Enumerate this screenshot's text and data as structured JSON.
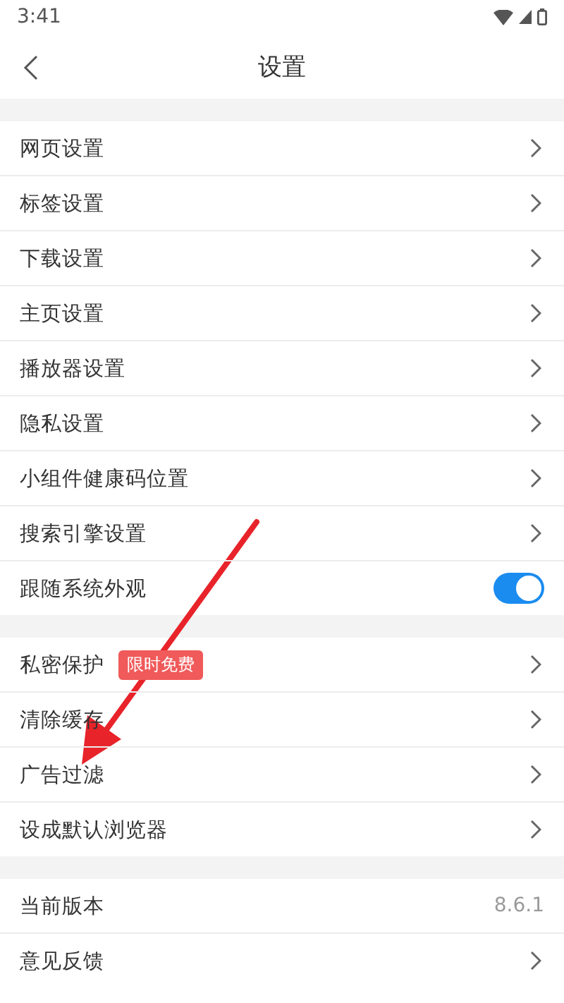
{
  "status_bar": {
    "time": "3:41"
  },
  "header": {
    "title": "设置"
  },
  "sections": [
    {
      "rows": [
        {
          "kind": "link",
          "label": "网页设置"
        },
        {
          "kind": "link",
          "label": "标签设置"
        },
        {
          "kind": "link",
          "label": "下载设置"
        },
        {
          "kind": "link",
          "label": "主页设置"
        },
        {
          "kind": "link",
          "label": "播放器设置"
        },
        {
          "kind": "link",
          "label": "隐私设置"
        },
        {
          "kind": "link",
          "label": "小组件健康码位置"
        },
        {
          "kind": "link",
          "label": "搜索引擎设置"
        },
        {
          "kind": "toggle",
          "label": "跟随系统外观",
          "on": true
        }
      ]
    },
    {
      "rows": [
        {
          "kind": "link",
          "label": "私密保护",
          "badge": "限时免费"
        },
        {
          "kind": "link",
          "label": "清除缓存"
        },
        {
          "kind": "link",
          "label": "广告过滤"
        },
        {
          "kind": "link",
          "label": "设成默认浏览器"
        }
      ]
    },
    {
      "rows": [
        {
          "kind": "value",
          "label": "当前版本",
          "value": "8.6.1"
        },
        {
          "kind": "link",
          "label": "意见反馈"
        }
      ]
    }
  ]
}
